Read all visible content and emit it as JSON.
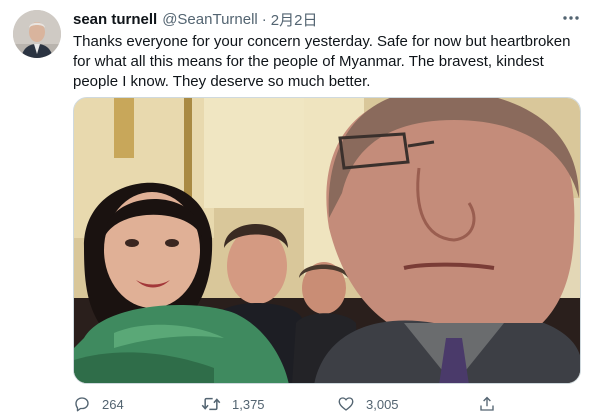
{
  "author": {
    "name": "sean turnell",
    "handle": "@SeanTurnell",
    "separator": "·",
    "date": "2月2日"
  },
  "tweet": {
    "text": "Thanks everyone for your concern yesterday. Safe for now but heartbroken for what all this means for the people of Myanmar. The bravest, kindest people I know. They deserve so much better."
  },
  "actions": {
    "reply_count": "264",
    "retweet_count": "1,375",
    "like_count": "3,005"
  },
  "icons": {
    "more": "more-horizontal-icon",
    "reply": "reply-icon",
    "retweet": "retweet-icon",
    "like": "heart-icon",
    "share": "share-icon"
  },
  "colors": {
    "text_primary": "#0f1419",
    "text_secondary": "#536471",
    "border": "#cfd9de"
  }
}
